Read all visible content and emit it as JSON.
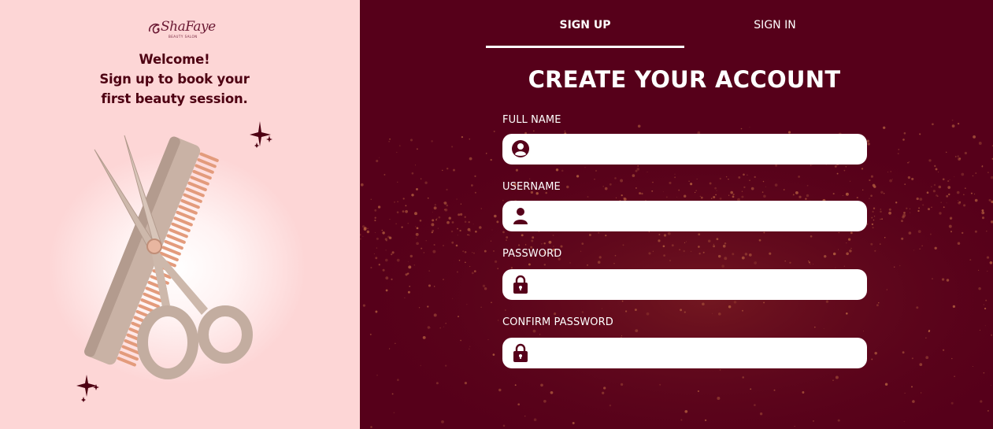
{
  "brand": {
    "logo_script": "ShaFaye",
    "logo_subtitle": "BEAUTY SALON"
  },
  "welcome": {
    "line1": "Welcome!",
    "line2": "Sign up to book your",
    "line3": "first beauty session."
  },
  "tabs": [
    {
      "label": "SIGN UP",
      "active": true
    },
    {
      "label": "SIGN IN",
      "active": false
    }
  ],
  "form": {
    "title": "CREATE YOUR ACCOUNT",
    "fields": [
      {
        "label": "FULL NAME",
        "icon": "user-circle-icon",
        "value": ""
      },
      {
        "label": "USERNAME",
        "icon": "user-icon",
        "value": ""
      },
      {
        "label": "PASSWORD",
        "icon": "lock-icon",
        "value": ""
      },
      {
        "label": "CONFIRM PASSWORD",
        "icon": "lock-icon",
        "value": ""
      }
    ]
  },
  "colors": {
    "left_bg": "#fdd6d6",
    "right_bg": "#56001a",
    "accent": "#4e0012",
    "glitter": "#b5603f"
  }
}
